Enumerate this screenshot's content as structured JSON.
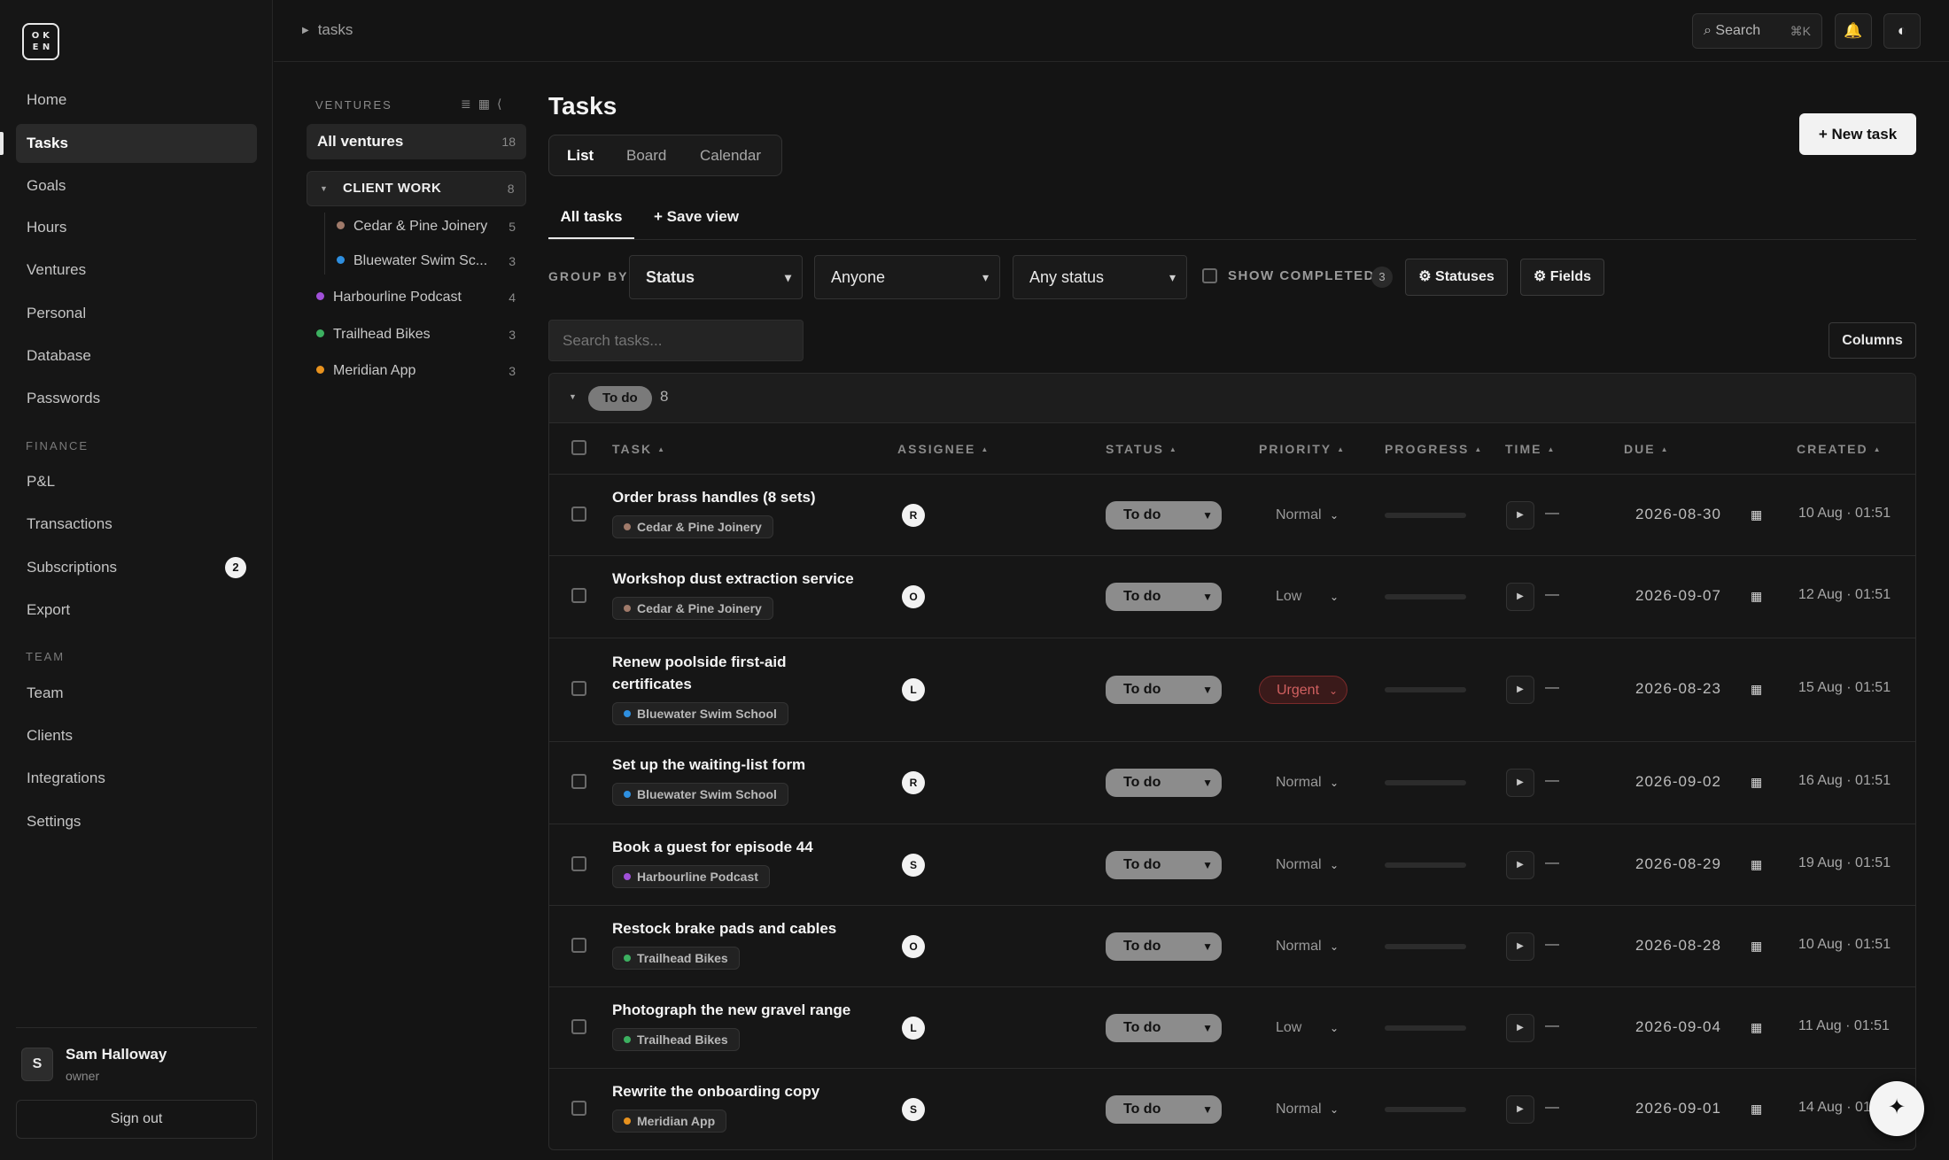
{
  "brand": {
    "logo_letters": [
      "O",
      "K",
      "E",
      "N"
    ]
  },
  "nav": {
    "items": [
      {
        "label": "Home"
      },
      {
        "label": "Tasks",
        "active": true
      },
      {
        "label": "Goals"
      },
      {
        "label": "Hours"
      },
      {
        "label": "Ventures"
      },
      {
        "label": "Personal"
      },
      {
        "label": "Database"
      },
      {
        "label": "Passwords"
      }
    ],
    "finance_title": "FINANCE",
    "finance_items": [
      {
        "label": "P&L"
      },
      {
        "label": "Transactions"
      },
      {
        "label": "Subscriptions",
        "badge": "2"
      },
      {
        "label": "Export"
      }
    ],
    "team_title": "TEAM",
    "team_items": [
      {
        "label": "Team"
      },
      {
        "label": "Clients"
      },
      {
        "label": "Integrations"
      },
      {
        "label": "Settings"
      }
    ]
  },
  "user": {
    "initial": "S",
    "name": "Sam Halloway",
    "role": "owner",
    "sign_out": "Sign out"
  },
  "topbar": {
    "breadcrumb": "tasks",
    "search_label": "Search",
    "search_shortcut": "⌘K",
    "bell_icon": "bell-icon",
    "theme_icon": "theme-toggle-icon"
  },
  "ventures": {
    "title": "VENTURES",
    "all_label": "All ventures",
    "all_count": "18",
    "group": {
      "label": "CLIENT WORK",
      "count": "8"
    },
    "children": [
      {
        "label": "Cedar & Pine Joinery",
        "count": "5",
        "color": "#a07a6a"
      },
      {
        "label": "Bluewater Swim Sc...",
        "count": "3",
        "color": "#2e8fe0"
      }
    ],
    "others": [
      {
        "label": "Harbourline Podcast",
        "count": "4",
        "color": "#a050d8"
      },
      {
        "label": "Trailhead Bikes",
        "count": "3",
        "color": "#3cb060"
      },
      {
        "label": "Meridian App",
        "count": "3",
        "color": "#e8921e"
      }
    ]
  },
  "main": {
    "title": "Tasks",
    "new_task": "+ New task",
    "view_tabs": [
      "List",
      "Board",
      "Calendar"
    ],
    "subtabs": {
      "all": "All tasks",
      "save": "+ Save view"
    },
    "group_by_label": "GROUP BY",
    "group_by_value": "Status",
    "assignee_filter": "Anyone",
    "status_filter": "Any status",
    "show_completed_label": "SHOW COMPLETED",
    "show_completed_count": "3",
    "statuses_btn": "⚙ Statuses",
    "fields_btn": "⚙ Fields",
    "search_placeholder": "Search tasks...",
    "columns_btn": "Columns"
  },
  "table": {
    "group": {
      "label": "To do",
      "count": "8"
    },
    "columns": [
      "TASK",
      "ASSIGNEE",
      "STATUS",
      "PRIORITY",
      "PROGRESS",
      "TIME",
      "DUE",
      "CREATED"
    ],
    "rows": [
      {
        "title": "Order brass handles (8 sets)",
        "venture": "Cedar & Pine Joinery",
        "venture_color": "#a07a6a",
        "assignee": "R",
        "status": "To do",
        "priority": "Normal",
        "time": "—",
        "due": "2026-08-30",
        "created": "10 Aug · 01:51"
      },
      {
        "title": "Workshop dust extraction service",
        "venture": "Cedar & Pine Joinery",
        "venture_color": "#a07a6a",
        "assignee": "O",
        "status": "To do",
        "priority": "Low",
        "time": "—",
        "due": "2026-09-07",
        "created": "12 Aug · 01:51"
      },
      {
        "title": "Renew poolside first-aid certificates",
        "venture": "Bluewater Swim School",
        "venture_color": "#2e8fe0",
        "assignee": "L",
        "status": "To do",
        "priority": "Urgent",
        "time": "—",
        "due": "2026-08-23",
        "created": "15 Aug · 01:51"
      },
      {
        "title": "Set up the waiting-list form",
        "venture": "Bluewater Swim School",
        "venture_color": "#2e8fe0",
        "assignee": "R",
        "status": "To do",
        "priority": "Normal",
        "time": "—",
        "due": "2026-09-02",
        "created": "16 Aug · 01:51"
      },
      {
        "title": "Book a guest for episode 44",
        "venture": "Harbourline Podcast",
        "venture_color": "#a050d8",
        "assignee": "S",
        "status": "To do",
        "priority": "Normal",
        "time": "—",
        "due": "2026-08-29",
        "created": "19 Aug · 01:51"
      },
      {
        "title": "Restock brake pads and cables",
        "venture": "Trailhead Bikes",
        "venture_color": "#3cb060",
        "assignee": "O",
        "status": "To do",
        "priority": "Normal",
        "time": "—",
        "due": "2026-08-28",
        "created": "10 Aug · 01:51"
      },
      {
        "title": "Photograph the new gravel range",
        "venture": "Trailhead Bikes",
        "venture_color": "#3cb060",
        "assignee": "L",
        "status": "To do",
        "priority": "Low",
        "time": "—",
        "due": "2026-09-04",
        "created": "11 Aug · 01:51"
      },
      {
        "title": "Rewrite the onboarding copy",
        "venture": "Meridian App",
        "venture_color": "#e8921e",
        "assignee": "S",
        "status": "To do",
        "priority": "Normal",
        "time": "—",
        "due": "2026-09-01",
        "created": "14 Aug · 01:51"
      }
    ]
  },
  "fab_icon": "sparkle-icon"
}
